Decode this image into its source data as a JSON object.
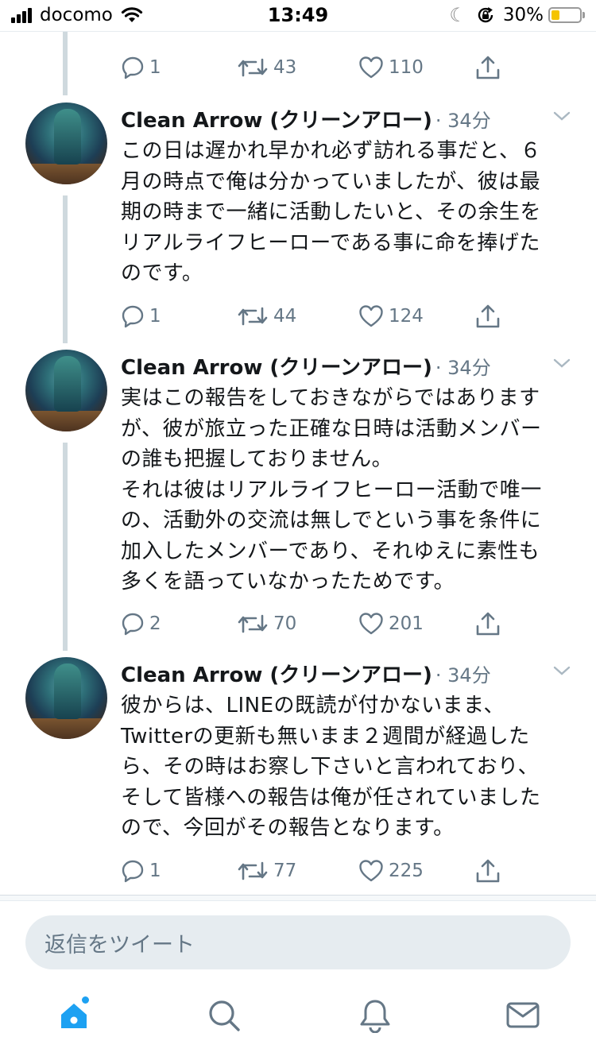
{
  "status_bar": {
    "carrier": "docomo",
    "time": "13:49",
    "battery_percent": "30%",
    "battery_level": 0.3,
    "icons": [
      "signal-bars-icon",
      "wifi-icon",
      "moon-icon",
      "orientation-lock-icon",
      "battery-icon"
    ]
  },
  "top_actions": {
    "replies": "1",
    "retweets": "43",
    "likes": "110"
  },
  "tweets": [
    {
      "name": "Clean Arrow (クリーンアロー)",
      "time": "· 34分",
      "lines": [
        "この日は遅かれ早かれ必ず訪れる事だと、６",
        "月の時点で俺は分かっていましたが、彼は最",
        "期の時まで一緒に活動したいと、その余生を",
        "リアルライフヒーローである事に命を捧げた",
        "のです。"
      ],
      "replies": "1",
      "retweets": "44",
      "likes": "124"
    },
    {
      "name": "Clean Arrow (クリーンアロー)",
      "time": "· 34分",
      "lines": [
        "実はこの報告をしておきながらではあります",
        "が、彼が旅立った正確な日時は活動メンバー",
        "の誰も把握しておりません。",
        "それは彼はリアルライフヒーロー活動で唯一",
        "の、活動外の交流は無しでという事を条件に",
        "加入したメンバーであり、それゆえに素性も",
        "多くを語っていなかったためです。"
      ],
      "replies": "2",
      "retweets": "70",
      "likes": "201"
    },
    {
      "name": "Clean Arrow (クリーンアロー)",
      "time": "· 34分",
      "lines": [
        "彼からは、LINEの既読が付かないまま、",
        "Twitterの更新も無いまま２週間が経過した",
        "ら、その時はお察し下さいと言われており、",
        "そして皆様への報告は俺が任されていました",
        "ので、今回がその報告となります。"
      ],
      "replies": "1",
      "retweets": "77",
      "likes": "225"
    }
  ],
  "reply_bar": {
    "placeholder": "返信をツイート"
  },
  "bottom_nav": {
    "items": [
      "home-icon",
      "search-icon",
      "notifications-icon",
      "messages-icon"
    ],
    "accent_color": "#1da1f2",
    "inactive_color": "#657786"
  }
}
